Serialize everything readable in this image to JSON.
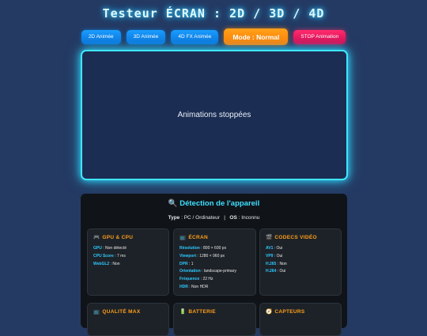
{
  "header": {
    "title": "Testeur ÉCRAN : 2D / 3D / 4D"
  },
  "buttons": {
    "anim2d": "2D Animée",
    "anim3d": "3D Animée",
    "anim4d": "4D FX Animée",
    "mode": "Mode : Normal",
    "stop": "STOP Animation"
  },
  "screen": {
    "status": "Animations stoppées"
  },
  "detection": {
    "title": "🔍 Détection de l'appareil",
    "type_label": "Type",
    "type_value": " : PC / Ordinateur",
    "separator": "|",
    "os_label": "OS",
    "os_value": " : Inconnu"
  },
  "cards": {
    "gpu": {
      "icon": "🎮",
      "title": "GPU & CPU",
      "rows": [
        {
          "k": "GPU",
          "v": " : Non détecté"
        },
        {
          "k": "CPU Score",
          "v": " : 7 ms"
        },
        {
          "k": "WebGL2",
          "v": " : Non"
        }
      ]
    },
    "ecran": {
      "icon": "📺",
      "title": "ÉCRAN",
      "rows": [
        {
          "k": "Résolution",
          "v": " : 800 × 600 px"
        },
        {
          "k": "Viewport",
          "v": " : 1280 × 960 px"
        },
        {
          "k": "DPR",
          "v": " : 1"
        },
        {
          "k": "Orientation",
          "v": " : landscape-primary"
        },
        {
          "k": "Fréquence",
          "v": " : 22 Hz"
        },
        {
          "k": "HDR",
          "v": " : Non HDR"
        }
      ]
    },
    "codecs": {
      "icon": "🎬",
      "title": "CODECS VIDÉO",
      "rows": [
        {
          "k": "AV1",
          "v": " : Oui"
        },
        {
          "k": "VP9",
          "v": " : Oui"
        },
        {
          "k": "H.265",
          "v": " : Non"
        },
        {
          "k": "H.264",
          "v": " : Oui"
        }
      ]
    },
    "qualite": {
      "icon": "📺",
      "title": "QUALITÉ MAX"
    },
    "batterie": {
      "icon": "🔋",
      "title": "BATTERIE"
    },
    "capteurs": {
      "icon": "🧭",
      "title": "CAPTEURS"
    }
  },
  "colors": {
    "accent_cyan": "#3fe6ff",
    "key_blue": "#2fc9ff",
    "card_title_orange": "#ff9f1a",
    "mode_orange": "#ff8c00",
    "stop_pink": "#ff2c6e",
    "button_blue": "#1a9dff"
  }
}
